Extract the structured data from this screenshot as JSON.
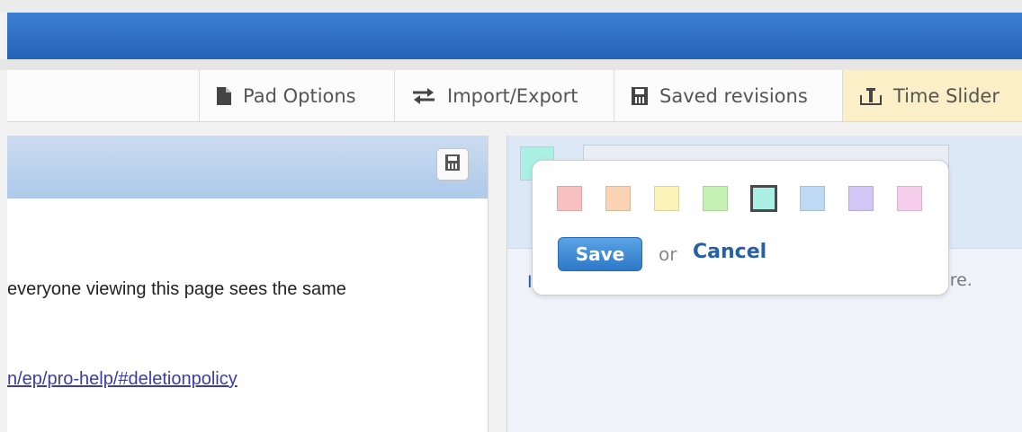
{
  "toolbar": {
    "pad_options": "Pad Options",
    "import_export": "Import/Export",
    "saved_revisions": "Saved revisions",
    "time_slider": "Time Slider"
  },
  "editor": {
    "text_line": "everyone viewing this page sees the same",
    "link_text": "n/ep/pro-help/#deletionpolicy"
  },
  "users_panel": {
    "link_fragment": "I",
    "text_fragment": "ere."
  },
  "color_picker": {
    "swatches": [
      "#f7c1c1",
      "#f9d3b3",
      "#fbf3b8",
      "#c4f1b3",
      "#aaf0e4",
      "#bdd9f4",
      "#d1c6f5",
      "#f6cdea"
    ],
    "selected_index": 4,
    "save_label": "Save",
    "or_label": "or",
    "cancel_label": "Cancel"
  },
  "colors": {
    "header_blue": "#2f71c4",
    "time_slider_bg": "#fbefc7"
  }
}
